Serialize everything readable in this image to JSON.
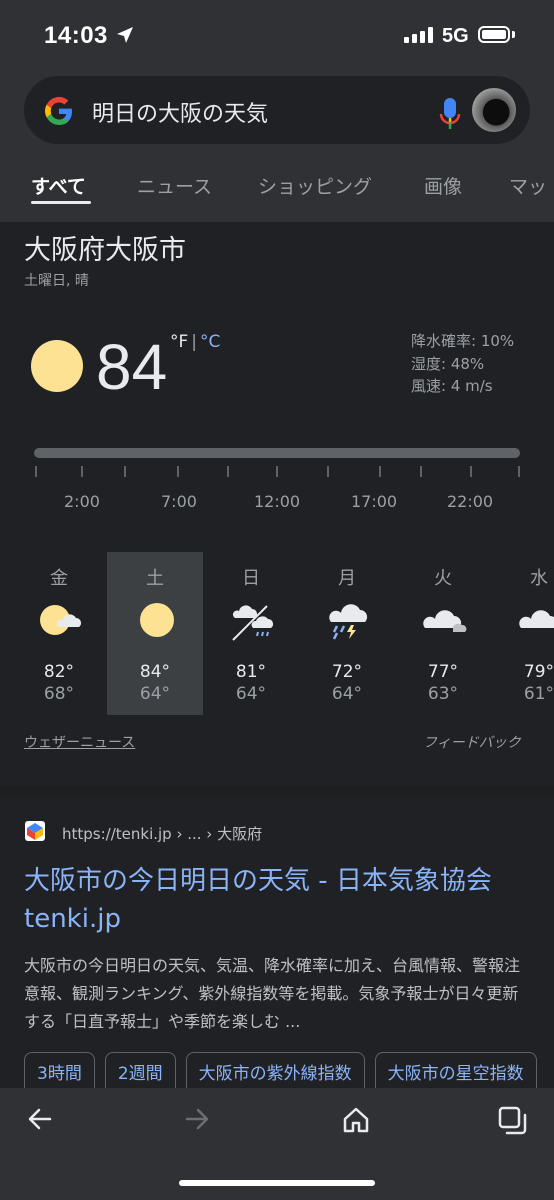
{
  "status_bar": {
    "time": "14:03",
    "network": "5G"
  },
  "search": {
    "query": "明日の大阪の天気"
  },
  "tabs": [
    {
      "label": "すべて",
      "active": true
    },
    {
      "label": "ニュース"
    },
    {
      "label": "ショッピング"
    },
    {
      "label": "画像"
    },
    {
      "label": "マッ"
    }
  ],
  "weather": {
    "location": "大阪府大阪市",
    "day_condition": "土曜日, 晴",
    "temperature": "84",
    "unit_f": "°F",
    "unit_sep": "|",
    "unit_c": "°C",
    "precipitation": "降水確率: 10%",
    "humidity": "湿度: 48%",
    "wind": "風速: 4 m/s",
    "hours": [
      "2:00",
      "7:00",
      "12:00",
      "17:00",
      "22:00"
    ],
    "forecast": [
      {
        "day": "金",
        "icon": "partly-sunny-icon",
        "high": "82°",
        "low": "68°"
      },
      {
        "day": "土",
        "icon": "sunny-icon",
        "high": "84°",
        "low": "64°",
        "selected": true
      },
      {
        "day": "日",
        "icon": "cloud-rain-icon",
        "high": "81°",
        "low": "64°"
      },
      {
        "day": "月",
        "icon": "thunderstorm-icon",
        "high": "72°",
        "low": "64°"
      },
      {
        "day": "火",
        "icon": "cloudy-icon",
        "high": "77°",
        "low": "63°"
      },
      {
        "day": "水",
        "icon": "cloudy-icon",
        "high": "79°",
        "low": "61°"
      }
    ],
    "weather_news": "ウェザーニュース",
    "feedback": "フィードバック"
  },
  "result": {
    "breadcrumb": "https://tenki.jp › ... › 大阪府",
    "title": "大阪市の今日明日の天気 - 日本気象協会 tenki.jp",
    "snippet": "大阪市の今日明日の天気、気温、降水確率に加え、台風情報、警報注意報、観測ランキング、紫外線指数等を掲載。気象予報士が日々更新する「日直予報士」や季節を楽しむ ...",
    "chips": [
      "3時間",
      "2週間",
      "大阪市の紫外線指数",
      "大阪市の星空指数"
    ]
  },
  "colors": {
    "accent": "#8ab4f8",
    "sun": "#fde293",
    "background": "#202124"
  }
}
